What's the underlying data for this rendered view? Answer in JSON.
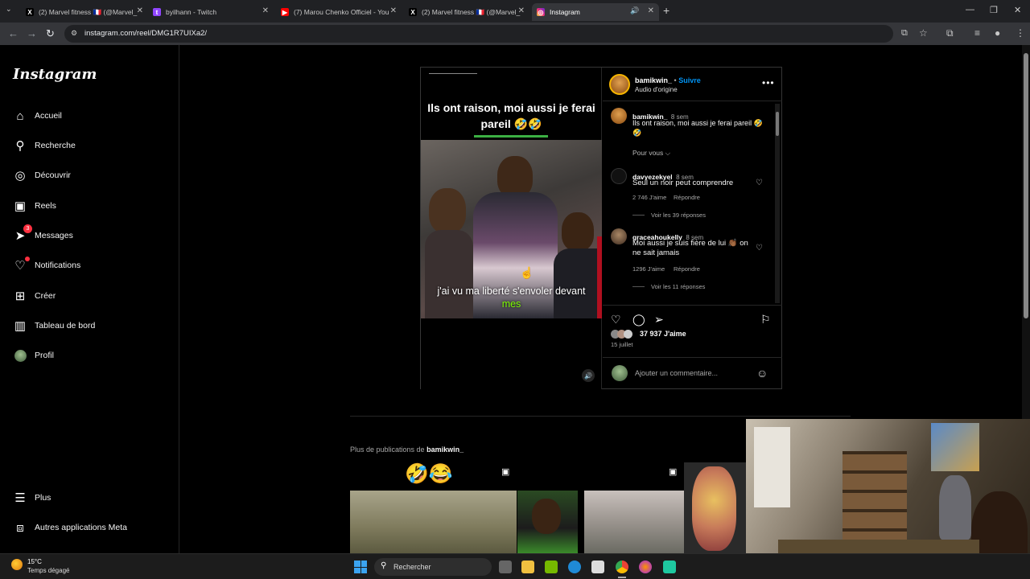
{
  "browser": {
    "tabs": [
      {
        "label": "(2) Marvel fitness 🇫🇷 (@Marvel_",
        "icon": "x-icon"
      },
      {
        "label": "byilhann - Twitch",
        "icon": "twitch-icon"
      },
      {
        "label": "(7) Marou Chenko Officiel - You",
        "icon": "youtube-icon"
      },
      {
        "label": "(2) Marvel fitness 🇫🇷 (@Marvel_",
        "icon": "x-icon"
      },
      {
        "label": "Instagram",
        "icon": "instagram-icon"
      }
    ],
    "new_tab": "+",
    "url": "instagram.com/reel/DMG1R7UIXa2/"
  },
  "sidebar": {
    "logo": "Instagram",
    "items": [
      {
        "label": "Accueil",
        "icon": "home-icon"
      },
      {
        "label": "Recherche",
        "icon": "search-icon"
      },
      {
        "label": "Découvrir",
        "icon": "compass-icon"
      },
      {
        "label": "Reels",
        "icon": "reels-icon"
      },
      {
        "label": "Messages",
        "icon": "messenger-icon",
        "badge": "3"
      },
      {
        "label": "Notifications",
        "icon": "heart-icon"
      },
      {
        "label": "Créer",
        "icon": "plus-square-icon"
      },
      {
        "label": "Tableau de bord",
        "icon": "dashboard-icon"
      },
      {
        "label": "Profil",
        "icon": "avatar"
      }
    ],
    "bottom": [
      {
        "label": "Plus",
        "icon": "menu-icon"
      },
      {
        "label": "Autres applications Meta",
        "icon": "meta-apps-icon"
      }
    ]
  },
  "post": {
    "video_caption": "Ils ont raison, moi aussi je ferai pareil 🤣🤣",
    "video_subtitle_main": "j'ai vu ma liberté s'envoler devant",
    "video_subtitle_highlight": "mes",
    "author": "bamikwin_",
    "separator": "•",
    "follow": "Suivre",
    "audio": "Audio d'origine",
    "caption_user": "bamikwin_",
    "caption_time": "8 sem",
    "caption_text": "Ils ont raison, moi aussi je ferai pareil 🤣🤣",
    "see_more": "Pour vous ⌵",
    "comments": [
      {
        "user": "davyezekyel",
        "time": "8 sem",
        "text": "Seul un noir peut comprendre",
        "likes": "2 746 J'aime",
        "reply": "Répondre",
        "replies": "Voir les 39 réponses"
      },
      {
        "user": "graceahoukelly",
        "time": "8 sem",
        "text": "Moi aussi je suis fière de lui 👏🏾 on ne sait jamais",
        "likes": "1296 J'aime",
        "reply": "Répondre",
        "replies": "Voir les 11 réponses"
      }
    ],
    "likes": "37 937 J'aime",
    "date": "15 juillet",
    "comment_placeholder": "Ajouter un commentaire..."
  },
  "more_posts": {
    "title_prefix": "Plus de publications de",
    "title_user": "bamikwin_"
  },
  "taskbar": {
    "temp": "15°C",
    "weather": "Temps dégagé",
    "search": "Rechercher"
  },
  "colors": {
    "follow_blue": "#0095f6",
    "badge_red": "#ff3040",
    "subtitle_green": "#7cfc00"
  }
}
